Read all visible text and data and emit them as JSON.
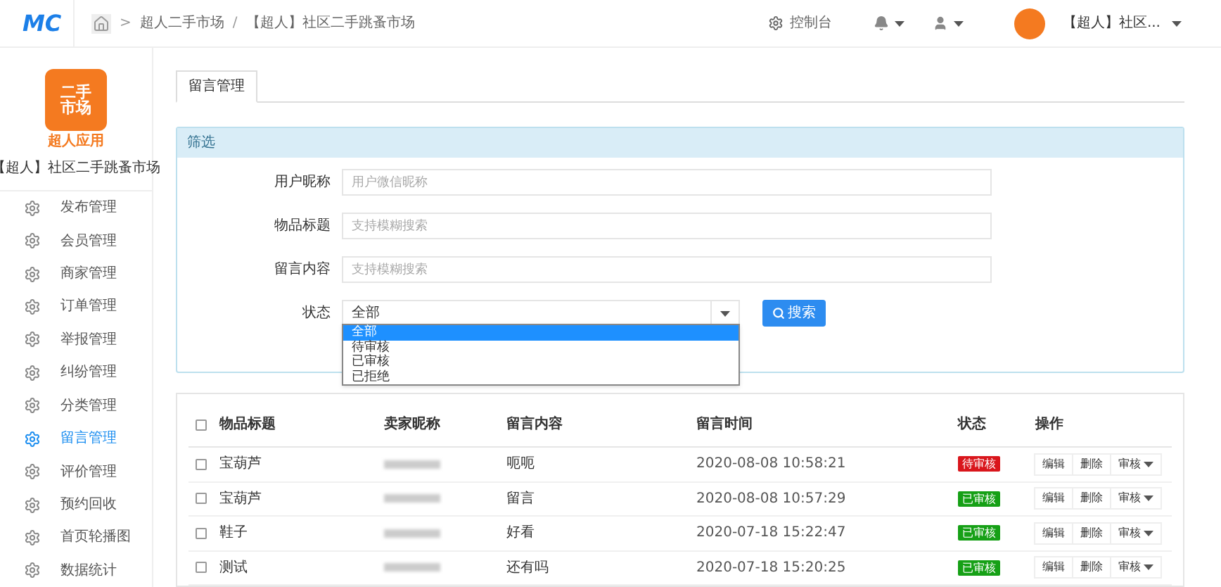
{
  "header": {
    "logo": "MC",
    "breadcrumb": [
      {
        "separator": ">",
        "label": "超人二手市场"
      },
      {
        "separator": "/",
        "label": "【超人】社区二手跳蚤市场"
      }
    ],
    "console": "控制台",
    "account": "【超人】社区..."
  },
  "sidebar": {
    "app_icon": {
      "line1": "二手",
      "line2": "市场",
      "line3": "超人应用"
    },
    "app_name": "【超人】社区二手跳蚤市场",
    "items": [
      {
        "label": "发布管理",
        "selected": false
      },
      {
        "label": "会员管理",
        "selected": false
      },
      {
        "label": "商家管理",
        "selected": false
      },
      {
        "label": "订单管理",
        "selected": false
      },
      {
        "label": "举报管理",
        "selected": false
      },
      {
        "label": "纠纷管理",
        "selected": false
      },
      {
        "label": "分类管理",
        "selected": false
      },
      {
        "label": "留言管理",
        "selected": true
      },
      {
        "label": "评价管理",
        "selected": false
      },
      {
        "label": "预约回收",
        "selected": false
      },
      {
        "label": "首页轮播图",
        "selected": false
      },
      {
        "label": "数据统计",
        "selected": false
      }
    ]
  },
  "tabs": [
    {
      "label": "留言管理",
      "selected": true
    }
  ],
  "filter": {
    "title": "筛选",
    "fields": [
      {
        "label": "用户昵称",
        "placeholder": "用户微信昵称"
      },
      {
        "label": "物品标题",
        "placeholder": "支持模糊搜索"
      },
      {
        "label": "留言内容",
        "placeholder": "支持模糊搜索"
      }
    ],
    "status": {
      "label": "状态",
      "value": "全部",
      "expanded": true,
      "options": [
        {
          "label": "全部",
          "selected": true
        },
        {
          "label": "待审核",
          "selected": false
        },
        {
          "label": "已审核",
          "selected": false
        },
        {
          "label": "已拒绝",
          "selected": false
        }
      ]
    },
    "search_button": "搜索"
  },
  "table": {
    "all_checked": false,
    "columns": [
      "物品标题",
      "卖家昵称",
      "留言内容",
      "留言时间",
      "状态",
      "操作"
    ],
    "rows": [
      {
        "checked": false,
        "title": "宝葫芦",
        "content": "呃呃",
        "time": "2020-08-08 10:58:21",
        "status": "待审核",
        "color": "#d9161c",
        "actions": [
          "编辑",
          "删除",
          "审核"
        ]
      },
      {
        "checked": false,
        "title": "宝葫芦",
        "content": "留言",
        "time": "2020-08-08 10:57:29",
        "status": "已审核",
        "color": "#16a016",
        "actions": [
          "编辑",
          "删除",
          "审核"
        ]
      },
      {
        "checked": false,
        "title": "鞋子",
        "content": "好看",
        "time": "2020-07-18 15:22:47",
        "status": "已审核",
        "color": "#16a016",
        "actions": [
          "编辑",
          "删除",
          "审核"
        ]
      },
      {
        "checked": false,
        "title": "测试",
        "content": "还有吗",
        "time": "2020-07-18 15:20:25",
        "status": "已审核",
        "color": "#16a016",
        "actions": [
          "编辑",
          "删除",
          "审核"
        ]
      }
    ]
  }
}
